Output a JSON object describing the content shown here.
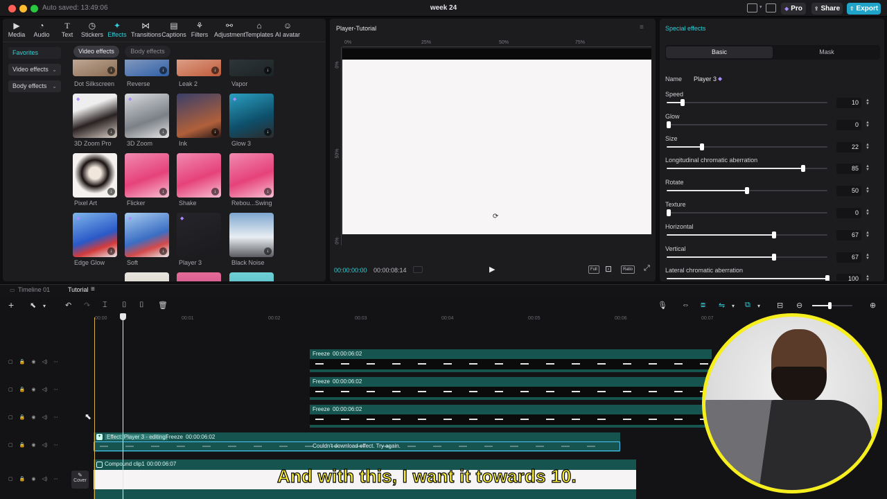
{
  "titlebar": {
    "autosave": "Auto saved: 13:49:06",
    "title": "week 24",
    "pro_label": "Pro",
    "share_label": "Share",
    "export_label": "Export"
  },
  "colors": {
    "accent": "#31d0d8",
    "export_bg": "#1fa3c8",
    "clip_teal": "#16554f",
    "subtitle": "#fff33b"
  },
  "toolbar": [
    {
      "label": "Media",
      "icon": "media-icon"
    },
    {
      "label": "Audio",
      "icon": "audio-icon"
    },
    {
      "label": "Text",
      "icon": "text-icon"
    },
    {
      "label": "Stickers",
      "icon": "stickers-icon"
    },
    {
      "label": "Effects",
      "icon": "effects-icon"
    },
    {
      "label": "Transitions",
      "icon": "transitions-icon"
    },
    {
      "label": "Captions",
      "icon": "captions-icon"
    },
    {
      "label": "Filters",
      "icon": "filters-icon"
    },
    {
      "label": "Adjustment",
      "icon": "adjustment-icon"
    },
    {
      "label": "Templates",
      "icon": "templates-icon"
    },
    {
      "label": "AI avatar",
      "icon": "ai-avatar-icon"
    }
  ],
  "sidebar": {
    "items": [
      {
        "label": "Favorites"
      },
      {
        "label": "Video effects"
      },
      {
        "label": "Body effects"
      }
    ]
  },
  "effect_tabs": {
    "video": "Video effects",
    "body": "Body effects"
  },
  "effects": [
    {
      "label": "Dot Silkscreen"
    },
    {
      "label": "Reverse"
    },
    {
      "label": "Leak 2"
    },
    {
      "label": "Vapor"
    },
    {
      "label": "3D Zoom Pro"
    },
    {
      "label": "3D Zoom"
    },
    {
      "label": "Ink"
    },
    {
      "label": "Glow 3"
    },
    {
      "label": "Pixel Art"
    },
    {
      "label": "Flicker"
    },
    {
      "label": "Shake"
    },
    {
      "label": "Rebou...Swing"
    },
    {
      "label": "Edge Glow"
    },
    {
      "label": "Soft"
    },
    {
      "label": "Player 3"
    },
    {
      "label": "Black Noise"
    }
  ],
  "player": {
    "title": "Player-Tutorial",
    "ruler_h": [
      "0%",
      "25%",
      "50%",
      "75%"
    ],
    "ruler_v": [
      "0%",
      "50%",
      "0%"
    ],
    "time_current": "00:00:00:00",
    "time_total": "00:00:08:14",
    "full_label": "Full",
    "ratio_label": "Ratio"
  },
  "special_effects": {
    "title": "Special effects",
    "tab_basic": "Basic",
    "tab_mask": "Mask",
    "name_label": "Name",
    "name_value": "Player 3",
    "props": [
      {
        "label": "Speed",
        "value": "10",
        "level": 0.1
      },
      {
        "label": "Glow",
        "value": "0",
        "level": 0.0
      },
      {
        "label": "Size",
        "value": "22",
        "level": 0.22
      },
      {
        "label": "Longitudinal chromatic aberration",
        "value": "85",
        "level": 0.85
      },
      {
        "label": "Rotate",
        "value": "50",
        "level": 0.5
      },
      {
        "label": "Texture",
        "value": "0",
        "level": 0.0
      },
      {
        "label": "Horizontal",
        "value": "67",
        "level": 0.67
      },
      {
        "label": "Vertical",
        "value": "67",
        "level": 0.67
      },
      {
        "label": "Lateral chromatic aberration",
        "value": "100",
        "level": 1.0
      }
    ]
  },
  "timeline": {
    "tab1": "Timeline 01",
    "tab2": "Tutorial",
    "ruler": [
      "00:00",
      "00:01",
      "00:02",
      "00:03",
      "00:04",
      "00:05",
      "00:06",
      "00:07"
    ],
    "freeze_label": "Freeze",
    "freeze_duration": "00:00:06:02",
    "effect_label": "Effect: Player 3 - editing",
    "effect_error": "Couldn't download effect. Try again.",
    "compound_label": "Compound clip1",
    "compound_duration": "00:00:06:07",
    "cover_label": "Cover"
  },
  "subtitle": "And with this, I want it towards 10."
}
